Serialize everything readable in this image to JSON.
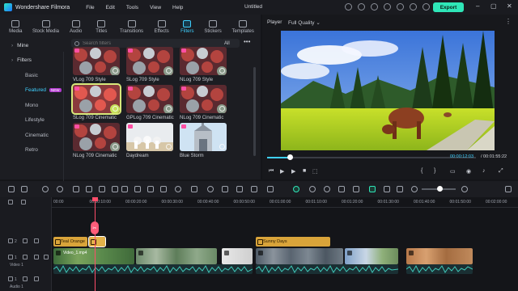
{
  "app": {
    "name": "Wondershare Filmora",
    "document_title": "Untitled"
  },
  "menu": [
    "File",
    "Edit",
    "Tools",
    "View",
    "Help"
  ],
  "title_icons": [
    "device-icon",
    "upload-icon",
    "cloud-icon",
    "gift-icon",
    "user-icon",
    "grid-icon",
    "messages-icon"
  ],
  "export_label": "Export",
  "window_controls": [
    "–",
    "▢",
    "✕"
  ],
  "tabs": [
    {
      "label": "Media",
      "icon": "media-icon"
    },
    {
      "label": "Stock Media",
      "icon": "stock-media-icon"
    },
    {
      "label": "Audio",
      "icon": "audio-icon"
    },
    {
      "label": "Titles",
      "icon": "titles-icon"
    },
    {
      "label": "Transitions",
      "icon": "transitions-icon"
    },
    {
      "label": "Effects",
      "icon": "effects-icon"
    },
    {
      "label": "Filters",
      "icon": "filters-icon",
      "active": true
    },
    {
      "label": "Stickers",
      "icon": "stickers-icon"
    },
    {
      "label": "Templates",
      "icon": "templates-icon"
    }
  ],
  "sidebar": {
    "items": [
      {
        "label": "Mine",
        "type": "group"
      },
      {
        "label": "Filters",
        "type": "group"
      },
      {
        "label": "Basic",
        "type": "sub"
      },
      {
        "label": "Featured",
        "type": "sub",
        "active": true,
        "badge": "NEW"
      },
      {
        "label": "Mono",
        "type": "sub"
      },
      {
        "label": "Lifestyle",
        "type": "sub"
      },
      {
        "label": "Cinematic",
        "type": "sub"
      },
      {
        "label": "Retro",
        "type": "sub"
      }
    ]
  },
  "search": {
    "placeholder": "Search filters",
    "filter_value": "All"
  },
  "filters": [
    {
      "label": "VLog 709 Style",
      "style": "ornaments"
    },
    {
      "label": "SLog 709 Style",
      "style": "ornaments"
    },
    {
      "label": "NLog 709 Style",
      "style": "ornaments"
    },
    {
      "label": "SLog 709 Cinematic",
      "style": "ornaments-bright",
      "selected": true
    },
    {
      "label": "GPLog 709 Cinematic",
      "style": "ornaments"
    },
    {
      "label": "NLog 709 Cinematic",
      "style": "ornaments"
    },
    {
      "label": "NLog 709 Cinematic",
      "style": "ornaments"
    },
    {
      "label": "Daydream",
      "style": "daydream"
    },
    {
      "label": "Blue Storm",
      "style": "bluestorm"
    }
  ],
  "player": {
    "label": "Player",
    "quality": "Full Quality",
    "current_time": "00:00:12:03",
    "total_time": "/ 00:01:55:22",
    "progress": 0.11,
    "controls": [
      "⏮",
      "▶︎",
      "▶",
      "■",
      "⬚",
      "{",
      "}",
      "▭",
      "◉",
      "♪",
      "⤢"
    ]
  },
  "timeline": {
    "ruler": [
      "00:00",
      "00:00:10:00",
      "00:00:20:00",
      "00:00:30:00",
      "00:00:40:00",
      "00:00:50:00",
      "00:01:00:00",
      "00:01:10:00",
      "00:01:20:00",
      "00:01:30:00",
      "00:01:40:00",
      "00:01:50:00",
      "00:02:00:00"
    ],
    "playhead_fraction": 0.095,
    "playhead_icon": "scissors-icon",
    "effect_clips": [
      {
        "label": "Teal Orange"
      },
      {
        "label": ""
      },
      {
        "label": "Sunny Days"
      }
    ],
    "video_clips": [
      {
        "label": "Video_1.mp4"
      },
      {
        "label": ""
      },
      {
        "label": ""
      },
      {
        "label": ""
      },
      {
        "label": ""
      },
      {
        "label": ""
      }
    ],
    "track_labels": {
      "effect": "2",
      "video": "Video 1",
      "video_num": "1",
      "audio": "Audio 1",
      "audio_num": "1"
    }
  },
  "colors": {
    "accent": "#2fe6b8",
    "active_tab": "#3fd0ff",
    "playhead": "#ff4d6a",
    "effect_clip": "#d9a43a",
    "audio_wave": "#3fc8b8"
  }
}
